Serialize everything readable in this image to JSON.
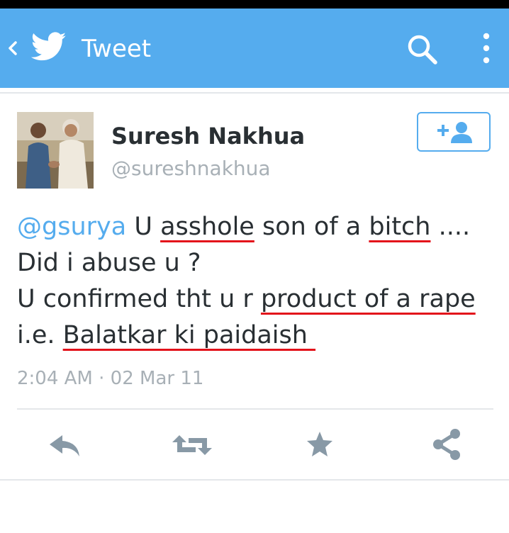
{
  "appbar": {
    "title": "Tweet",
    "icons": [
      "back-icon",
      "twitter-bird-icon",
      "search-icon",
      "overflow-menu-icon"
    ],
    "color": "#55acee"
  },
  "tweet": {
    "author_name": "Suresh Nakhua",
    "author_handle": "@sureshnakhua",
    "follow_icon": "add-user-icon",
    "lines": [
      [
        {
          "text": "@gsurya",
          "mention": true
        },
        {
          "text": " U "
        },
        {
          "text": "asshole",
          "underline": true
        },
        {
          "text": " son of a "
        },
        {
          "text": "bitch",
          "underline": true
        },
        {
          "text": " ...."
        }
      ],
      [
        {
          "text": "Did i abuse u ?"
        }
      ],
      [
        {
          "text": "U confirmed tht u r "
        },
        {
          "text": "product of a rape",
          "underline": true
        }
      ],
      [
        {
          "text": "i.e. "
        },
        {
          "text": "Balatkar ki paidaish ",
          "underline": true
        }
      ]
    ],
    "timestamp": "2:04 AM · 02 Mar 11",
    "underline_color": "#e3121b",
    "mention_color": "#55acee"
  },
  "actions": [
    {
      "name": "reply-button",
      "icon": "reply-icon"
    },
    {
      "name": "retweet-button",
      "icon": "retweet-icon"
    },
    {
      "name": "favorite-button",
      "icon": "star-icon"
    },
    {
      "name": "share-button",
      "icon": "share-icon"
    }
  ]
}
